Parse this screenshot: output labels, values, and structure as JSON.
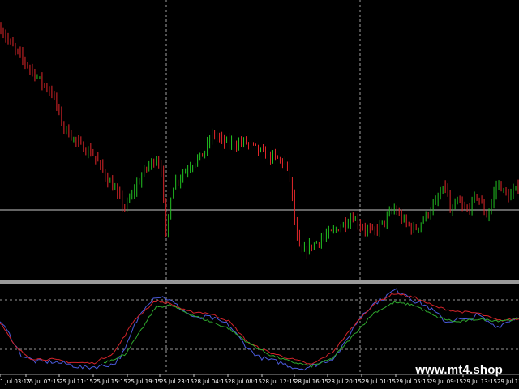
{
  "watermark": "www.mt4.shop",
  "colors": {
    "background": "#000000",
    "bull_candle": "#22c322",
    "bear_candle": "#e0262a",
    "grid": "#c8c8c8",
    "separator": "#9a9a9a",
    "osc_blue": "#4a5bdc",
    "osc_red": "#d2232a",
    "osc_green": "#2ea82e"
  },
  "chart_data": [
    {
      "type": "candlestick",
      "panel": "price",
      "grid": "dashed vertical lines at day boundaries",
      "horizontal_line": "solid grey level line",
      "close_profile": [
        [
          0,
          0.925
        ],
        [
          0.02,
          0.86
        ],
        [
          0.05,
          0.79
        ],
        [
          0.08,
          0.72
        ],
        [
          0.1,
          0.68
        ],
        [
          0.12,
          0.56
        ],
        [
          0.15,
          0.49
        ],
        [
          0.18,
          0.45
        ],
        [
          0.2,
          0.38
        ],
        [
          0.22,
          0.32
        ],
        [
          0.24,
          0.25
        ],
        [
          0.26,
          0.33
        ],
        [
          0.28,
          0.4
        ],
        [
          0.3,
          0.44
        ],
        [
          0.31,
          0.4
        ],
        [
          0.32,
          0.13
        ],
        [
          0.33,
          0.33
        ],
        [
          0.35,
          0.38
        ],
        [
          0.37,
          0.42
        ],
        [
          0.39,
          0.45
        ],
        [
          0.41,
          0.53
        ],
        [
          0.43,
          0.5
        ],
        [
          0.45,
          0.49
        ],
        [
          0.47,
          0.5
        ],
        [
          0.49,
          0.48
        ],
        [
          0.51,
          0.45
        ],
        [
          0.53,
          0.44
        ],
        [
          0.55,
          0.42
        ],
        [
          0.56,
          0.36
        ],
        [
          0.57,
          0.16
        ],
        [
          0.58,
          0.08
        ],
        [
          0.6,
          0.11
        ],
        [
          0.62,
          0.14
        ],
        [
          0.64,
          0.16
        ],
        [
          0.66,
          0.19
        ],
        [
          0.68,
          0.22
        ],
        [
          0.7,
          0.18
        ],
        [
          0.72,
          0.16
        ],
        [
          0.74,
          0.2
        ],
        [
          0.76,
          0.25
        ],
        [
          0.78,
          0.2
        ],
        [
          0.8,
          0.17
        ],
        [
          0.82,
          0.22
        ],
        [
          0.84,
          0.27
        ],
        [
          0.86,
          0.34
        ],
        [
          0.87,
          0.22
        ],
        [
          0.88,
          0.28
        ],
        [
          0.9,
          0.24
        ],
        [
          0.92,
          0.3
        ],
        [
          0.94,
          0.22
        ],
        [
          0.96,
          0.35
        ],
        [
          0.98,
          0.29
        ],
        [
          1,
          0.33
        ]
      ]
    },
    {
      "type": "line",
      "panel": "oscillator",
      "series": [
        {
          "color": "blue",
          "values": [
            [
              0,
              0.6
            ],
            [
              0.02,
              0.4
            ],
            [
              0.04,
              0.15
            ],
            [
              0.07,
              0.06
            ],
            [
              0.1,
              0.06
            ],
            [
              0.13,
              0.03
            ],
            [
              0.16,
              -0.02
            ],
            [
              0.19,
              0.0
            ],
            [
              0.22,
              0.03
            ],
            [
              0.24,
              0.2
            ],
            [
              0.26,
              0.55
            ],
            [
              0.28,
              0.8
            ],
            [
              0.3,
              0.92
            ],
            [
              0.32,
              0.9
            ],
            [
              0.34,
              0.8
            ],
            [
              0.36,
              0.7
            ],
            [
              0.38,
              0.62
            ],
            [
              0.4,
              0.65
            ],
            [
              0.42,
              0.6
            ],
            [
              0.44,
              0.55
            ],
            [
              0.46,
              0.38
            ],
            [
              0.48,
              0.22
            ],
            [
              0.5,
              0.12
            ],
            [
              0.52,
              0.08
            ],
            [
              0.54,
              0.05
            ],
            [
              0.56,
              0.0
            ],
            [
              0.58,
              -0.03
            ],
            [
              0.6,
              0.0
            ],
            [
              0.62,
              0.05
            ],
            [
              0.64,
              0.1
            ],
            [
              0.66,
              0.25
            ],
            [
              0.68,
              0.5
            ],
            [
              0.7,
              0.7
            ],
            [
              0.72,
              0.82
            ],
            [
              0.74,
              0.9
            ],
            [
              0.76,
              1.0
            ],
            [
              0.78,
              0.96
            ],
            [
              0.8,
              0.85
            ],
            [
              0.82,
              0.8
            ],
            [
              0.84,
              0.7
            ],
            [
              0.86,
              0.58
            ],
            [
              0.88,
              0.62
            ],
            [
              0.9,
              0.6
            ],
            [
              0.92,
              0.68
            ],
            [
              0.94,
              0.58
            ],
            [
              0.96,
              0.52
            ],
            [
              0.98,
              0.6
            ],
            [
              1,
              0.65
            ]
          ]
        },
        {
          "color": "red",
          "values": [
            [
              0,
              0.58
            ],
            [
              0.03,
              0.25
            ],
            [
              0.06,
              0.1
            ],
            [
              0.1,
              0.09
            ],
            [
              0.14,
              0.05
            ],
            [
              0.18,
              0.04
            ],
            [
              0.22,
              0.18
            ],
            [
              0.26,
              0.62
            ],
            [
              0.3,
              0.86
            ],
            [
              0.33,
              0.82
            ],
            [
              0.36,
              0.72
            ],
            [
              0.4,
              0.7
            ],
            [
              0.44,
              0.6
            ],
            [
              0.48,
              0.3
            ],
            [
              0.52,
              0.18
            ],
            [
              0.56,
              0.1
            ],
            [
              0.6,
              0.02
            ],
            [
              0.64,
              0.18
            ],
            [
              0.68,
              0.52
            ],
            [
              0.72,
              0.82
            ],
            [
              0.76,
              0.96
            ],
            [
              0.8,
              0.9
            ],
            [
              0.84,
              0.78
            ],
            [
              0.88,
              0.72
            ],
            [
              0.92,
              0.7
            ],
            [
              0.96,
              0.6
            ],
            [
              1,
              0.62
            ]
          ]
        },
        {
          "color": "green",
          "values": [
            [
              0.2,
              0.05
            ],
            [
              0.24,
              0.15
            ],
            [
              0.27,
              0.45
            ],
            [
              0.3,
              0.78
            ],
            [
              0.33,
              0.8
            ],
            [
              0.36,
              0.7
            ],
            [
              0.4,
              0.6
            ],
            [
              0.44,
              0.5
            ],
            [
              0.48,
              0.3
            ],
            [
              0.52,
              0.15
            ],
            [
              0.56,
              0.06
            ],
            [
              0.6,
              0.0
            ],
            [
              0.64,
              0.1
            ],
            [
              0.68,
              0.4
            ],
            [
              0.72,
              0.7
            ],
            [
              0.76,
              0.84
            ],
            [
              0.8,
              0.8
            ],
            [
              0.84,
              0.65
            ],
            [
              0.88,
              0.58
            ],
            [
              0.92,
              0.62
            ],
            [
              0.96,
              0.6
            ],
            [
              1,
              0.62
            ]
          ]
        }
      ]
    }
  ],
  "time_axis": [
    "1 Jul 03:15",
    "25 Jul 07:15",
    "25 Jul 11:15",
    "25 Jul 15:15",
    "25 Jul 19:15",
    "25 Jul 23:15",
    "28 Jul 04:15",
    "28 Jul 08:15",
    "28 Jul 12:15",
    "28 Jul 16:15",
    "28 Jul 20:15",
    "29 Jul 01:15",
    "29 Jul 05:15",
    "29 Jul 09:15",
    "29 Jul 13:15",
    "29 Jul 17:1"
  ]
}
